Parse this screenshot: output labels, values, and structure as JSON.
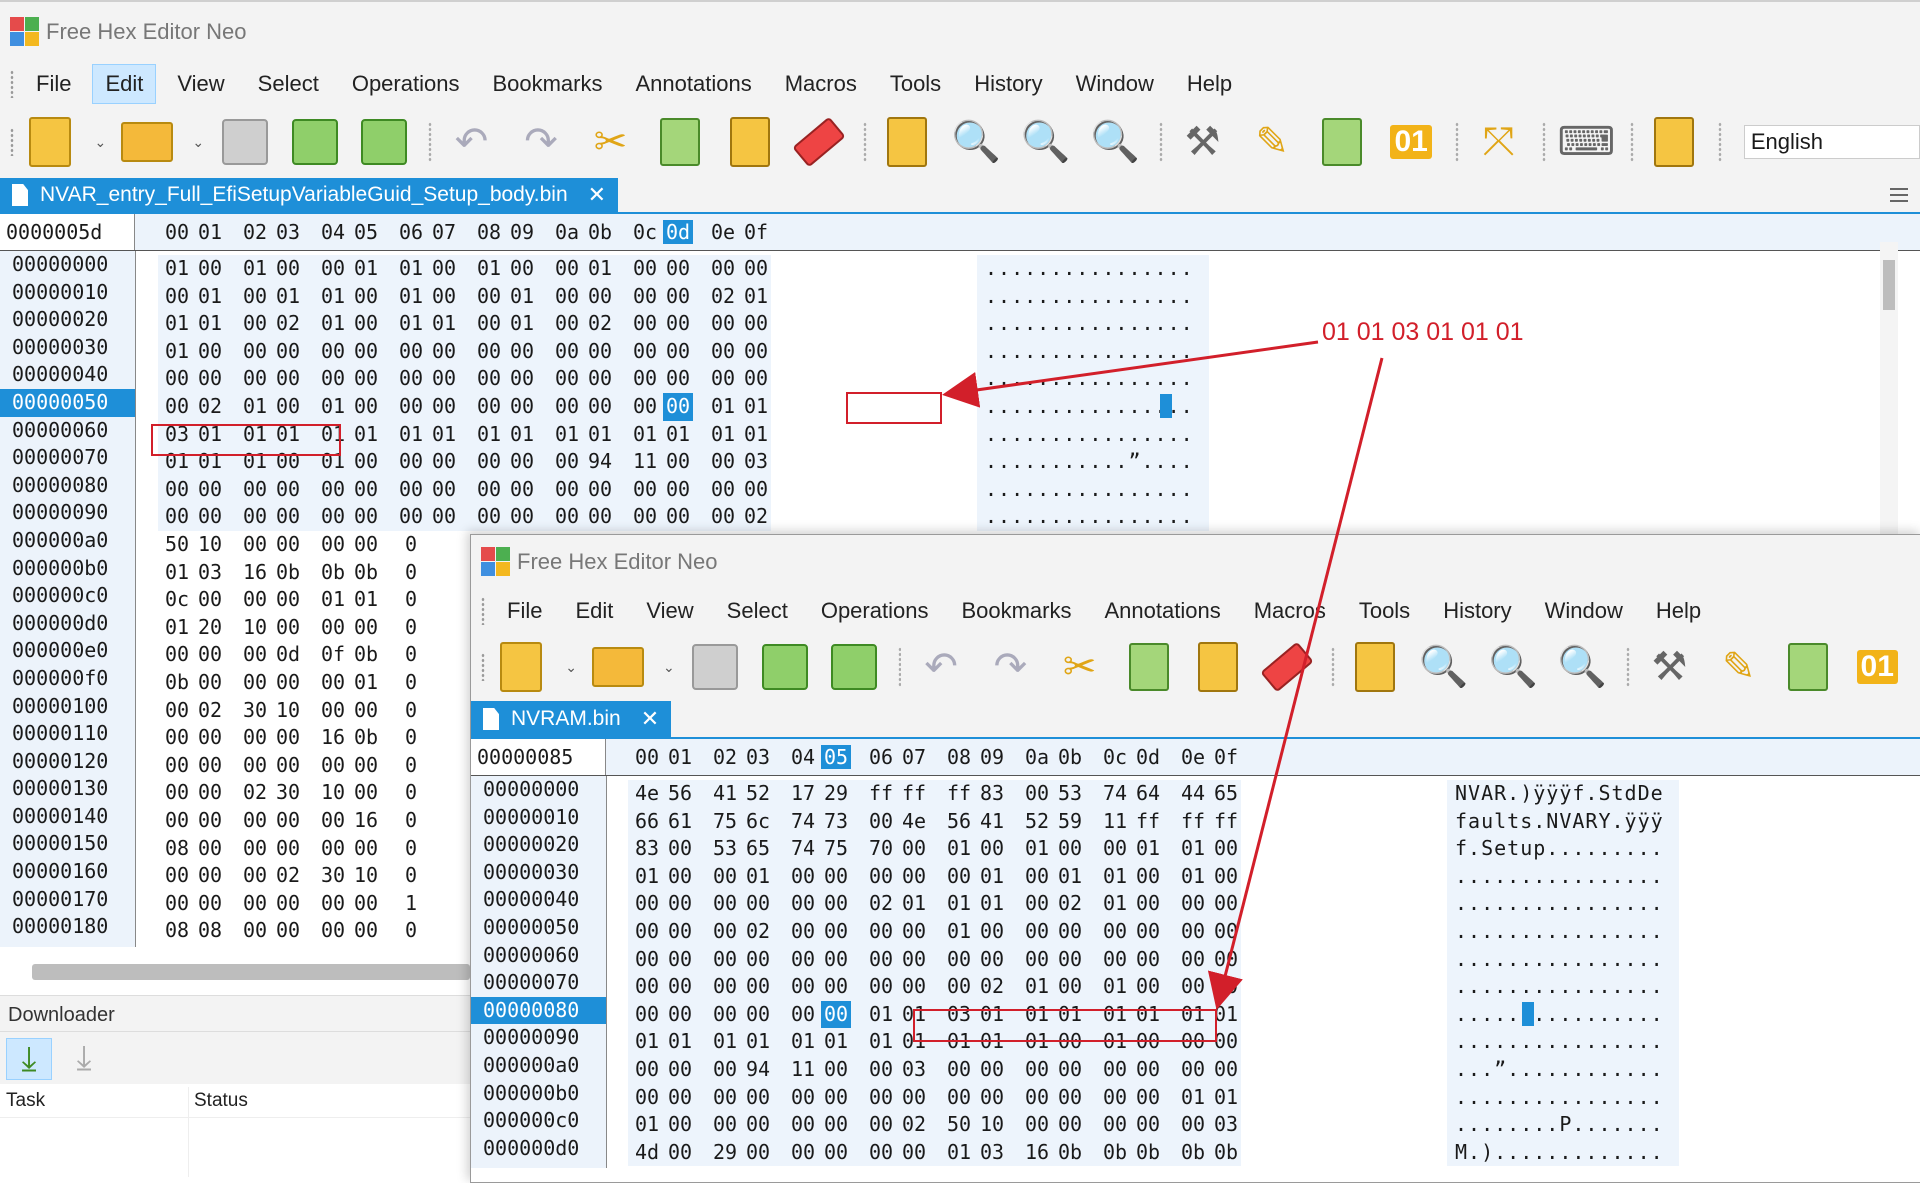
{
  "window1": {
    "title": "Free Hex Editor Neo",
    "menu": [
      "File",
      "Edit",
      "View",
      "Select",
      "Operations",
      "Bookmarks",
      "Annotations",
      "Macros",
      "Tools",
      "History",
      "Window",
      "Help"
    ],
    "active_menu": "Edit",
    "language": "English",
    "tab_label": "NVAR_entry_Full_EfiSetupVariableGuid_Setup_body.bin",
    "tab_close": "✕",
    "offset": "0000005d",
    "selected_column": "0d",
    "columns": [
      "00",
      "01",
      "02",
      "03",
      "04",
      "05",
      "06",
      "07",
      "08",
      "09",
      "0a",
      "0b",
      "0c",
      "0d",
      "0e",
      "0f"
    ],
    "selected_row": "00000050",
    "rows": [
      {
        "addr": "00000000",
        "bytes": [
          "01",
          "00",
          "01",
          "00",
          "00",
          "01",
          "01",
          "00",
          "01",
          "00",
          "00",
          "01",
          "00",
          "00",
          "00",
          "00"
        ],
        "ascii": "................"
      },
      {
        "addr": "00000010",
        "bytes": [
          "00",
          "01",
          "00",
          "01",
          "01",
          "00",
          "01",
          "00",
          "00",
          "01",
          "00",
          "00",
          "00",
          "00",
          "02",
          "01"
        ],
        "ascii": "................"
      },
      {
        "addr": "00000020",
        "bytes": [
          "01",
          "01",
          "00",
          "02",
          "01",
          "00",
          "01",
          "01",
          "00",
          "01",
          "00",
          "02",
          "00",
          "00",
          "00",
          "00"
        ],
        "ascii": "................"
      },
      {
        "addr": "00000030",
        "bytes": [
          "01",
          "00",
          "00",
          "00",
          "00",
          "00",
          "00",
          "00",
          "00",
          "00",
          "00",
          "00",
          "00",
          "00",
          "00",
          "00"
        ],
        "ascii": "................"
      },
      {
        "addr": "00000040",
        "bytes": [
          "00",
          "00",
          "00",
          "00",
          "00",
          "00",
          "00",
          "00",
          "00",
          "00",
          "00",
          "00",
          "00",
          "00",
          "00",
          "00"
        ],
        "ascii": "................"
      },
      {
        "addr": "00000050",
        "bytes": [
          "00",
          "02",
          "01",
          "00",
          "01",
          "00",
          "00",
          "00",
          "00",
          "00",
          "00",
          "00",
          "00",
          "00",
          "01",
          "01"
        ],
        "ascii": "................"
      },
      {
        "addr": "00000060",
        "bytes": [
          "03",
          "01",
          "01",
          "01",
          "01",
          "01",
          "01",
          "01",
          "01",
          "01",
          "01",
          "01",
          "01",
          "01",
          "01",
          "01"
        ],
        "ascii": "................"
      },
      {
        "addr": "00000070",
        "bytes": [
          "01",
          "01",
          "01",
          "00",
          "01",
          "00",
          "00",
          "00",
          "00",
          "00",
          "00",
          "94",
          "11",
          "00",
          "00",
          "03"
        ],
        "ascii": "...........”...."
      },
      {
        "addr": "00000080",
        "bytes": [
          "00",
          "00",
          "00",
          "00",
          "00",
          "00",
          "00",
          "00",
          "00",
          "00",
          "00",
          "00",
          "00",
          "00",
          "00",
          "00"
        ],
        "ascii": "................"
      },
      {
        "addr": "00000090",
        "bytes": [
          "00",
          "00",
          "00",
          "00",
          "00",
          "00",
          "00",
          "00",
          "00",
          "00",
          "00",
          "00",
          "00",
          "00",
          "00",
          "02"
        ],
        "ascii": "................"
      }
    ],
    "partial_rows": [
      {
        "addr": "000000a0",
        "bytes": [
          "50",
          "10",
          "00",
          "00",
          "00",
          "00",
          "0"
        ]
      },
      {
        "addr": "000000b0",
        "bytes": [
          "01",
          "03",
          "16",
          "0b",
          "0b",
          "0b",
          "0"
        ]
      },
      {
        "addr": "000000c0",
        "bytes": [
          "0c",
          "00",
          "00",
          "00",
          "01",
          "01",
          "0"
        ]
      },
      {
        "addr": "000000d0",
        "bytes": [
          "01",
          "20",
          "10",
          "00",
          "00",
          "00",
          "0"
        ]
      },
      {
        "addr": "000000e0",
        "bytes": [
          "00",
          "00",
          "00",
          "0d",
          "0f",
          "0b",
          "0"
        ]
      },
      {
        "addr": "000000f0",
        "bytes": [
          "0b",
          "00",
          "00",
          "00",
          "00",
          "01",
          "0"
        ]
      },
      {
        "addr": "00000100",
        "bytes": [
          "00",
          "02",
          "30",
          "10",
          "00",
          "00",
          "0"
        ]
      },
      {
        "addr": "00000110",
        "bytes": [
          "00",
          "00",
          "00",
          "00",
          "16",
          "0b",
          "0"
        ]
      },
      {
        "addr": "00000120",
        "bytes": [
          "00",
          "00",
          "00",
          "00",
          "00",
          "00",
          "0"
        ]
      },
      {
        "addr": "00000130",
        "bytes": [
          "00",
          "00",
          "02",
          "30",
          "10",
          "00",
          "0"
        ]
      },
      {
        "addr": "00000140",
        "bytes": [
          "00",
          "00",
          "00",
          "00",
          "00",
          "16",
          "0"
        ]
      },
      {
        "addr": "00000150",
        "bytes": [
          "08",
          "00",
          "00",
          "00",
          "00",
          "00",
          "0"
        ]
      },
      {
        "addr": "00000160",
        "bytes": [
          "00",
          "00",
          "00",
          "02",
          "30",
          "10",
          "0"
        ]
      },
      {
        "addr": "00000170",
        "bytes": [
          "00",
          "00",
          "00",
          "00",
          "00",
          "00",
          "1"
        ]
      },
      {
        "addr": "00000180",
        "bytes": [
          "08",
          "08",
          "00",
          "00",
          "00",
          "00",
          "0"
        ]
      }
    ]
  },
  "downloader": {
    "title": "Downloader",
    "columns": [
      "Task",
      "Status"
    ]
  },
  "window2": {
    "title": "Free Hex Editor Neo",
    "menu": [
      "File",
      "Edit",
      "View",
      "Select",
      "Operations",
      "Bookmarks",
      "Annotations",
      "Macros",
      "Tools",
      "History",
      "Window",
      "Help"
    ],
    "tab_label": "NVRAM.bin",
    "tab_close": "✕",
    "offset": "00000085",
    "selected_column": "05",
    "columns": [
      "00",
      "01",
      "02",
      "03",
      "04",
      "05",
      "06",
      "07",
      "08",
      "09",
      "0a",
      "0b",
      "0c",
      "0d",
      "0e",
      "0f"
    ],
    "selected_row": "00000080",
    "rows": [
      {
        "addr": "00000000",
        "bytes": [
          "4e",
          "56",
          "41",
          "52",
          "17",
          "29",
          "ff",
          "ff",
          "ff",
          "83",
          "00",
          "53",
          "74",
          "64",
          "44",
          "65"
        ],
        "ascii": "NVAR.)ÿÿÿf.StdDe"
      },
      {
        "addr": "00000010",
        "bytes": [
          "66",
          "61",
          "75",
          "6c",
          "74",
          "73",
          "00",
          "4e",
          "56",
          "41",
          "52",
          "59",
          "11",
          "ff",
          "ff",
          "ff"
        ],
        "ascii": "faults.NVARY.ÿÿÿ"
      },
      {
        "addr": "00000020",
        "bytes": [
          "83",
          "00",
          "53",
          "65",
          "74",
          "75",
          "70",
          "00",
          "01",
          "00",
          "01",
          "00",
          "00",
          "01",
          "01",
          "00"
        ],
        "ascii": "f.Setup........."
      },
      {
        "addr": "00000030",
        "bytes": [
          "01",
          "00",
          "00",
          "01",
          "00",
          "00",
          "00",
          "00",
          "00",
          "01",
          "00",
          "01",
          "01",
          "00",
          "01",
          "00"
        ],
        "ascii": "................"
      },
      {
        "addr": "00000040",
        "bytes": [
          "00",
          "00",
          "00",
          "00",
          "00",
          "00",
          "02",
          "01",
          "01",
          "01",
          "00",
          "02",
          "01",
          "00",
          "00",
          "00"
        ],
        "ascii": "................"
      },
      {
        "addr": "00000050",
        "bytes": [
          "00",
          "00",
          "00",
          "02",
          "00",
          "00",
          "00",
          "00",
          "01",
          "00",
          "00",
          "00",
          "00",
          "00",
          "00",
          "00"
        ],
        "ascii": "................"
      },
      {
        "addr": "00000060",
        "bytes": [
          "00",
          "00",
          "00",
          "00",
          "00",
          "00",
          "00",
          "00",
          "00",
          "00",
          "00",
          "00",
          "00",
          "00",
          "00",
          "00"
        ],
        "ascii": "................"
      },
      {
        "addr": "00000070",
        "bytes": [
          "00",
          "00",
          "00",
          "00",
          "00",
          "00",
          "00",
          "00",
          "00",
          "02",
          "01",
          "00",
          "01",
          "00",
          "00",
          "00"
        ],
        "ascii": "................"
      },
      {
        "addr": "00000080",
        "bytes": [
          "00",
          "00",
          "00",
          "00",
          "00",
          "00",
          "01",
          "01",
          "03",
          "01",
          "01",
          "01",
          "01",
          "01",
          "01",
          "01"
        ],
        "ascii": "................"
      },
      {
        "addr": "00000090",
        "bytes": [
          "01",
          "01",
          "01",
          "01",
          "01",
          "01",
          "01",
          "01",
          "01",
          "01",
          "01",
          "00",
          "01",
          "00",
          "00",
          "00"
        ],
        "ascii": "................"
      },
      {
        "addr": "000000a0",
        "bytes": [
          "00",
          "00",
          "00",
          "94",
          "11",
          "00",
          "00",
          "03",
          "00",
          "00",
          "00",
          "00",
          "00",
          "00",
          "00",
          "00"
        ],
        "ascii": "...”............"
      },
      {
        "addr": "000000b0",
        "bytes": [
          "00",
          "00",
          "00",
          "00",
          "00",
          "00",
          "00",
          "00",
          "00",
          "00",
          "00",
          "00",
          "00",
          "00",
          "01",
          "01"
        ],
        "ascii": "................"
      },
      {
        "addr": "000000c0",
        "bytes": [
          "01",
          "00",
          "00",
          "00",
          "00",
          "00",
          "00",
          "02",
          "50",
          "10",
          "00",
          "00",
          "00",
          "00",
          "00",
          "03"
        ],
        "ascii": "........P......."
      },
      {
        "addr": "000000d0",
        "bytes": [
          "4d",
          "00",
          "29",
          "00",
          "00",
          "00",
          "00",
          "00",
          "01",
          "03",
          "16",
          "0b",
          "0b",
          "0b",
          "0b",
          "0b"
        ],
        "ascii": "M.)............."
      }
    ]
  },
  "annotation": {
    "text": "01 01 03 01 01 01",
    "color": "#d21f2a"
  },
  "colors": {
    "accent": "#1e8fd8",
    "header_bg": "#ecf3fb",
    "annotation": "#d21f2a"
  }
}
